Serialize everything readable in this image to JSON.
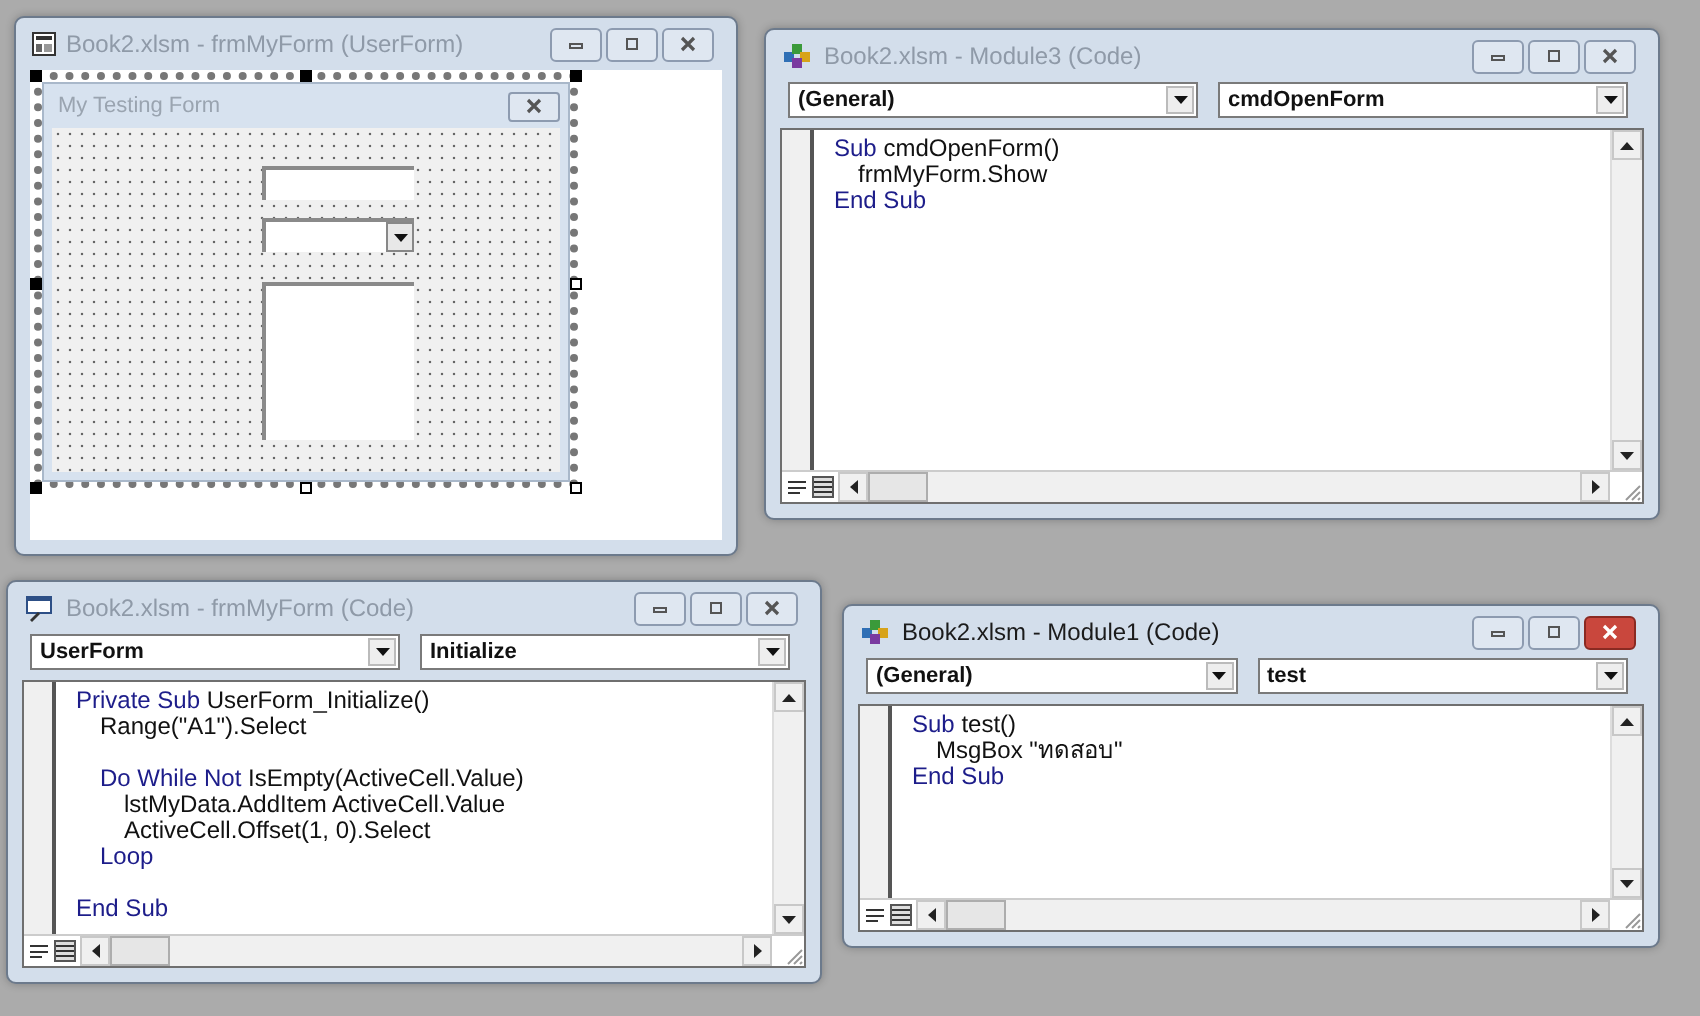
{
  "windows": [
    {
      "kind": "designer",
      "title": "Book2.xlsm - frmMyForm (UserForm)",
      "active": false,
      "form": {
        "title": "My Testing Form",
        "controls": [
          {
            "kind": "textbox"
          },
          {
            "kind": "combobox"
          },
          {
            "kind": "listbox"
          }
        ]
      }
    },
    {
      "kind": "module_code",
      "title": "Book2.xlsm - Module3 (Code)",
      "active": false,
      "object_dropdown": "(General)",
      "procedure_dropdown": "cmdOpenForm",
      "lines": [
        {
          "gap_before": false,
          "segments": [
            {
              "text": "Sub",
              "keyword": true
            },
            {
              "text": "cmdOpenForm()",
              "keyword": false
            }
          ],
          "children": [
            {
              "gap_before": false,
              "segments": [
                {
                  "text": "frmMyForm.Show",
                  "keyword": false
                }
              ]
            }
          ]
        },
        {
          "gap_before": false,
          "segments": [
            {
              "text": "End Sub",
              "keyword": true
            }
          ]
        }
      ]
    },
    {
      "kind": "form_code",
      "title": "Book2.xlsm - frmMyForm (Code)",
      "active": false,
      "object_dropdown": "UserForm",
      "procedure_dropdown": "Initialize",
      "lines": [
        {
          "gap_before": false,
          "segments": [
            {
              "text": "Private Sub",
              "keyword": true
            },
            {
              "text": "UserForm_Initialize()",
              "keyword": false
            }
          ],
          "children": [
            {
              "gap_before": false,
              "segments": [
                {
                  "text": "Range(\"A1\").Select",
                  "keyword": false
                }
              ]
            },
            {
              "gap_before": true,
              "segments": [
                {
                  "text": "Do While Not",
                  "keyword": true
                },
                {
                  "text": "IsEmpty(ActiveCell.Value)",
                  "keyword": false
                }
              ],
              "children": [
                {
                  "gap_before": false,
                  "segments": [
                    {
                      "text": "lstMyData.AddItem ActiveCell.Value",
                      "keyword": false
                    }
                  ]
                },
                {
                  "gap_before": false,
                  "segments": [
                    {
                      "text": "ActiveCell.Offset(1, 0).Select",
                      "keyword": false
                    }
                  ]
                }
              ]
            },
            {
              "gap_before": false,
              "segments": [
                {
                  "text": "Loop",
                  "keyword": true
                }
              ]
            }
          ]
        },
        {
          "gap_before": true,
          "segments": [
            {
              "text": "End Sub",
              "keyword": true
            }
          ]
        }
      ]
    },
    {
      "kind": "module_code",
      "title": "Book2.xlsm - Module1 (Code)",
      "active": true,
      "object_dropdown": "(General)",
      "procedure_dropdown": "test",
      "lines": [
        {
          "gap_before": false,
          "segments": [
            {
              "text": "Sub",
              "keyword": true
            },
            {
              "text": "test()",
              "keyword": false
            }
          ],
          "children": [
            {
              "gap_before": false,
              "segments": [
                {
                  "text": "MsgBox \"ทดสอบ\"",
                  "keyword": false
                }
              ]
            }
          ]
        },
        {
          "gap_before": false,
          "segments": [
            {
              "text": "End Sub",
              "keyword": true
            }
          ]
        }
      ]
    }
  ]
}
